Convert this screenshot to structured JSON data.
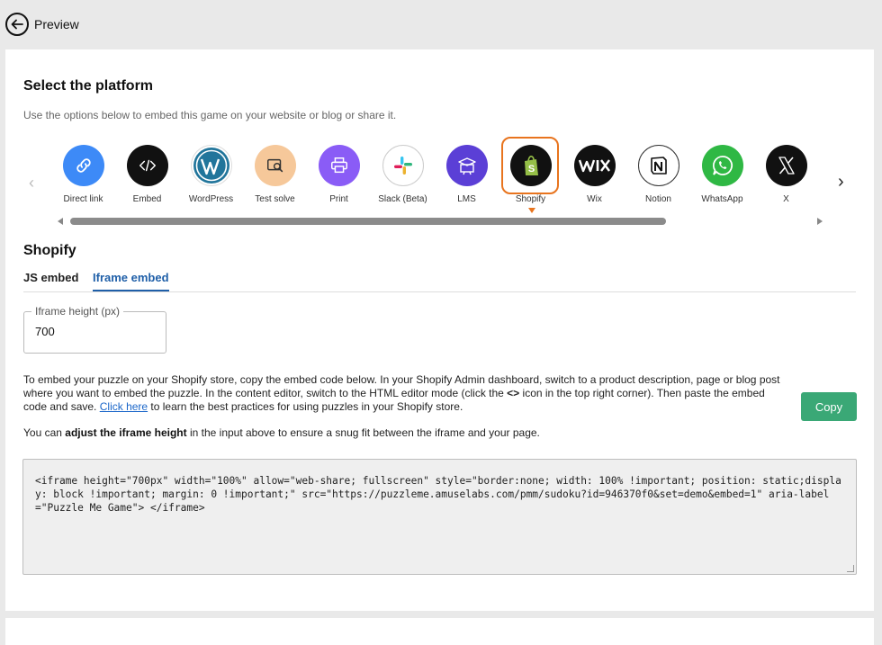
{
  "header": {
    "back_label": "Preview"
  },
  "colors": {
    "accent": "#1f5fa8",
    "selected": "#e8741e",
    "copy": "#3aa876"
  },
  "platform_section": {
    "title": "Select the platform",
    "subtitle": "Use the options below to embed this game on your website or blog or share it.",
    "selected": "Shopify",
    "platforms": [
      {
        "label": "Direct link",
        "icon": "link-icon",
        "color": "#3d8af7"
      },
      {
        "label": "Embed",
        "icon": "code-icon",
        "color": "#111111"
      },
      {
        "label": "WordPress",
        "icon": "wordpress-icon",
        "color": "#21759b"
      },
      {
        "label": "Test solve",
        "icon": "test-solve-icon",
        "color": "#f6c89a"
      },
      {
        "label": "Print",
        "icon": "printer-icon",
        "color": "#8a5cf6"
      },
      {
        "label": "Slack (Beta)",
        "icon": "slack-icon",
        "color": "#ffffff"
      },
      {
        "label": "LMS",
        "icon": "lms-icon",
        "color": "#5b3fd6"
      },
      {
        "label": "Shopify",
        "icon": "shopify-icon",
        "color": "#111111"
      },
      {
        "label": "Wix",
        "icon": "wix-icon",
        "color": "#111111"
      },
      {
        "label": "Notion",
        "icon": "notion-icon",
        "color": "#ffffff"
      },
      {
        "label": "WhatsApp",
        "icon": "whatsapp-icon",
        "color": "#2fb844"
      },
      {
        "label": "X",
        "icon": "x-icon",
        "color": "#111111"
      }
    ],
    "scroll_position": 0.78
  },
  "shopify": {
    "title": "Shopify",
    "tabs": [
      "JS embed",
      "Iframe embed"
    ],
    "active_tab": "Iframe embed",
    "height_field": {
      "label": "Iframe height (px)",
      "value": "700"
    },
    "description_1": "To embed your puzzle on your Shopify store, copy the embed code below. In your Shopify Admin dashboard, switch to a product description, page or blog post where you want to embed the puzzle. In the content editor, switch to the HTML editor mode (click the ",
    "description_icon": "<>",
    "description_2": " icon in the top right corner). Then paste the embed code and save. ",
    "link_text": "Click here",
    "description_3": " to learn the best practices for using puzzles in your Shopify store.",
    "tip_1": "You can ",
    "tip_bold": "adjust the iframe height",
    "tip_2": " in the input above to ensure a snug fit between the iframe and your page.",
    "copy_label": "Copy",
    "code": "<iframe height=\"700px\" width=\"100%\" allow=\"web-share; fullscreen\" style=\"border:none; width: 100% !important; position: static;display: block !important; margin: 0 !important;\" src=\"https://puzzleme.amuselabs.com/pmm/sudoku?id=946370f0&set=demo&embed=1\" aria-label=\"Puzzle Me Game\"> </iframe>"
  }
}
